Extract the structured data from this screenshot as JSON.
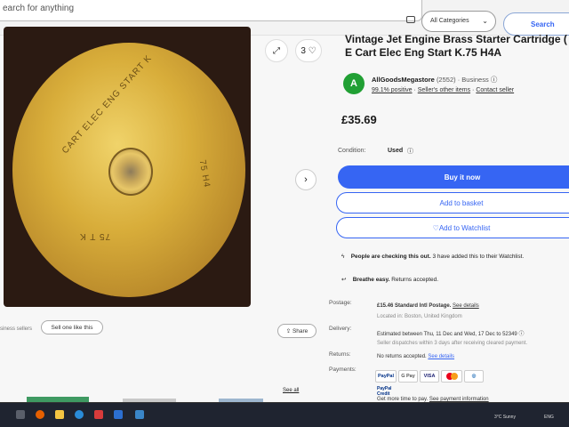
{
  "header": {
    "search_placeholder": "earch for anything",
    "category": "All Categories",
    "search_button": "Search"
  },
  "gallery": {
    "image_count": "3",
    "etch_line1": "CART ELEC ENG START K",
    "etch_line2": "75 H4",
    "etch_line3": "75 T K"
  },
  "left_bottom": {
    "note": "siness sellers",
    "sell_button": "Sell one like this",
    "share_button": "Share",
    "see_all": "See all"
  },
  "listing": {
    "title": "Vintage Jet Engine Brass Starter Cartridge ( E Cart Elec Eng Start K.75 H4A",
    "seller_avatar": "A",
    "seller_name": "AllGoodsMegastore",
    "seller_count": "(2552)",
    "seller_type": "· Business",
    "positive": "99.1% positive",
    "other_items": "Seller's other items",
    "contact": "Contact seller",
    "price": "£35.69",
    "condition_label": "Condition:",
    "condition_value": "Used",
    "buy_now": "Buy it now",
    "add_basket": "Add to basket",
    "add_watchlist": "Add to Watchlist",
    "checking_bold": "People are checking this out.",
    "checking_rest": "3 have added this to their Watchlist.",
    "returns_bold": "Breathe easy.",
    "returns_rest": "Returns accepted."
  },
  "details": {
    "postage_label": "Postage:",
    "postage_value": "£15.46 Standard Intl Postage.",
    "postage_link": "See details",
    "location": "Located in: Boston, United Kingdom",
    "delivery_label": "Delivery:",
    "delivery_value": "Estimated between Thu, 11 Dec and Wed, 17 Dec to 52349",
    "dispatch": "Seller dispatches within 3 days after receiving cleared payment.",
    "returns_label": "Returns:",
    "returns_value": "No returns accepted.",
    "returns_link": "See details",
    "payments_label": "Payments:",
    "pay_paypal": "PayPal",
    "pay_gpay": "G Pay",
    "pay_visa": "VISA",
    "paypal_credit": "PayPal Credit",
    "more_time": "Get more time to pay.",
    "payment_info": "See payment information"
  },
  "taskbar": {
    "weather": "3°C Sunny",
    "status": "ENG"
  },
  "colors": {
    "accent": "#3665f3",
    "seller_green": "#21a034",
    "taskbar": "#1f2430"
  }
}
